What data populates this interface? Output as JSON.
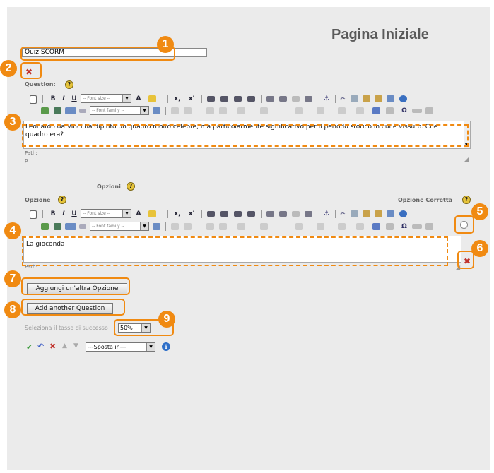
{
  "page": {
    "title": "Pagina Iniziale"
  },
  "quiz": {
    "name_value": "Quiz SCORM"
  },
  "question": {
    "label": "Question:",
    "text": "Leonardo da Vinci ha dipinto un quadro molto celebre, ma particolarmente significativo per il periodo storico in cui è vissuto. Che quadro era?",
    "path_label": "Path:",
    "path_value": "p"
  },
  "options": {
    "section_label": "Opzioni",
    "option_label": "Opzione",
    "correct_label": "Opzione Corretta",
    "option_text": "La gioconda",
    "path_label": "Path:"
  },
  "toolbar": {
    "font_size": "-- Font size --",
    "font_family": "-- Font family --",
    "bold": "B",
    "italic": "I",
    "underline": "U",
    "subscript": "x,",
    "superscript": "x'",
    "anchor": "⚓",
    "omega": "Ω",
    "cut": "✂"
  },
  "buttons": {
    "add_option": "Aggiungi un'altra Opzione",
    "add_question": "Add another Question"
  },
  "success": {
    "label": "Seleziona il tasso di successo",
    "value": "50%"
  },
  "move": {
    "placeholder": "---Sposta in---"
  },
  "callouts": [
    "1",
    "2",
    "3",
    "4",
    "5",
    "6",
    "7",
    "8",
    "9"
  ],
  "colors": {
    "accent": "#f08a12",
    "background": "#ebebeb",
    "delete": "#c0302a"
  },
  "icons": [
    "delete-icon",
    "help-icon",
    "confirm-icon",
    "undo-icon",
    "arrow-up-icon",
    "arrow-down-icon",
    "info-icon"
  ]
}
